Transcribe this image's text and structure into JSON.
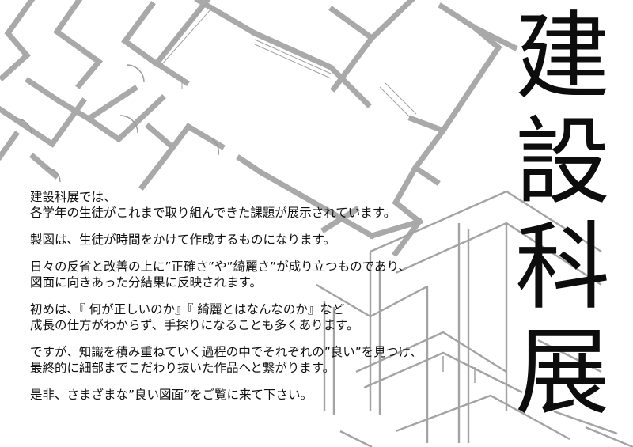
{
  "title_chars": [
    "建",
    "設",
    "科",
    "展"
  ],
  "paragraphs": [
    {
      "lines": [
        "建設科展では、",
        "各学年の生徒がこれまで取り組んできた課題が展示されています。"
      ]
    },
    {
      "lines": [
        "製図は、生徒が時間をかけて作成するものになります。"
      ]
    },
    {
      "lines": [
        "日々の反省と改善の上に”正確さ”や”綺麗さ”が成り立つものであり、",
        "図面に向きあった分結果に反映されます。"
      ]
    },
    {
      "lines": [
        "初めは、『 何が正しいのか』『 綺麗とはなんなのか』など",
        "成長の仕方がわからず、手探りになることも多くあります。"
      ]
    },
    {
      "lines": [
        "ですが、知識を積み重ねていく過程の中でそれぞれの”良い”を見つけ、",
        "最終的に細部までこだわり抜いた作品へと繋がります。"
      ]
    },
    {
      "lines": [
        "是非、さまざまな”良い図面”をご覧に来て下さい。"
      ]
    }
  ],
  "colors": {
    "background": "#ffffff",
    "text": "#111111",
    "drawing_lines": "#a9a9a9"
  }
}
